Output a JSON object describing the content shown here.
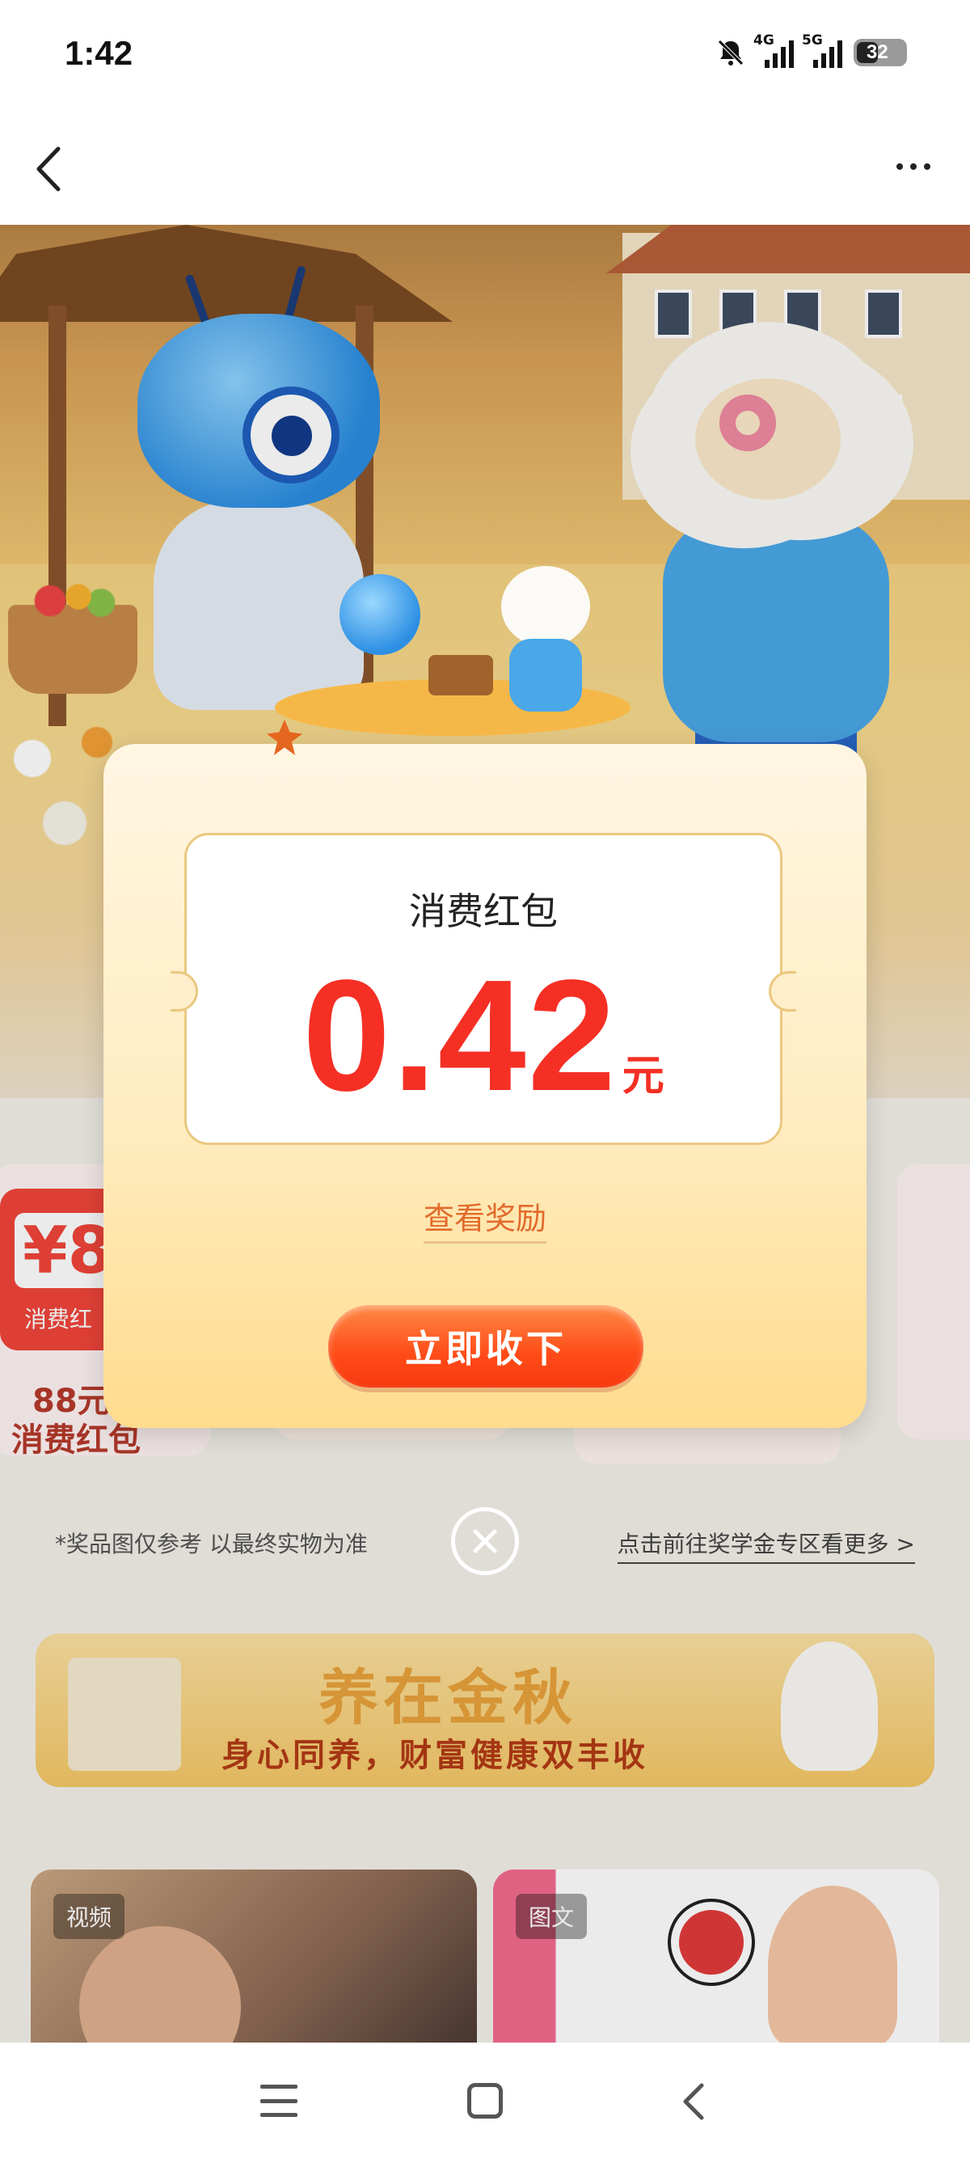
{
  "status_bar": {
    "time": "1:42",
    "network_1": "4G",
    "network_2": "5G",
    "battery": "32",
    "icons": [
      "bell-off-icon",
      "signal-icon",
      "signal-icon",
      "battery-icon"
    ]
  },
  "nav": {
    "back_icon": "chevron-left-icon",
    "more_icon": "more-dots-icon"
  },
  "modal": {
    "title": "消费红包",
    "amount": "0.42",
    "unit": "元",
    "view_link": "查看奖励",
    "accept_button": "立即收下",
    "close_icon": "close-circle-icon"
  },
  "background": {
    "prize_left_amount": "¥88",
    "prize_left_tag": "消费红",
    "prize_left_caption_1": "88元",
    "prize_left_caption_2": "消费红包",
    "notice": "*奖品图仅参考 以最终实物为准",
    "more_link": "点击前往奖学金专区看更多 >",
    "banner_title": "养在金秋",
    "banner_subtitle": "身心同养，财富健康双丰收",
    "feed": [
      {
        "tag": "视频"
      },
      {
        "tag": "图文"
      }
    ]
  },
  "system_nav": {
    "icons": [
      "menu-icon",
      "home-square-icon",
      "back-chevron-icon"
    ]
  },
  "colors": {
    "accent_red": "#f52f24",
    "button_orange": "#ff4b18",
    "link_orange": "#e16b2c",
    "modal_bg": "#ffecc0"
  }
}
